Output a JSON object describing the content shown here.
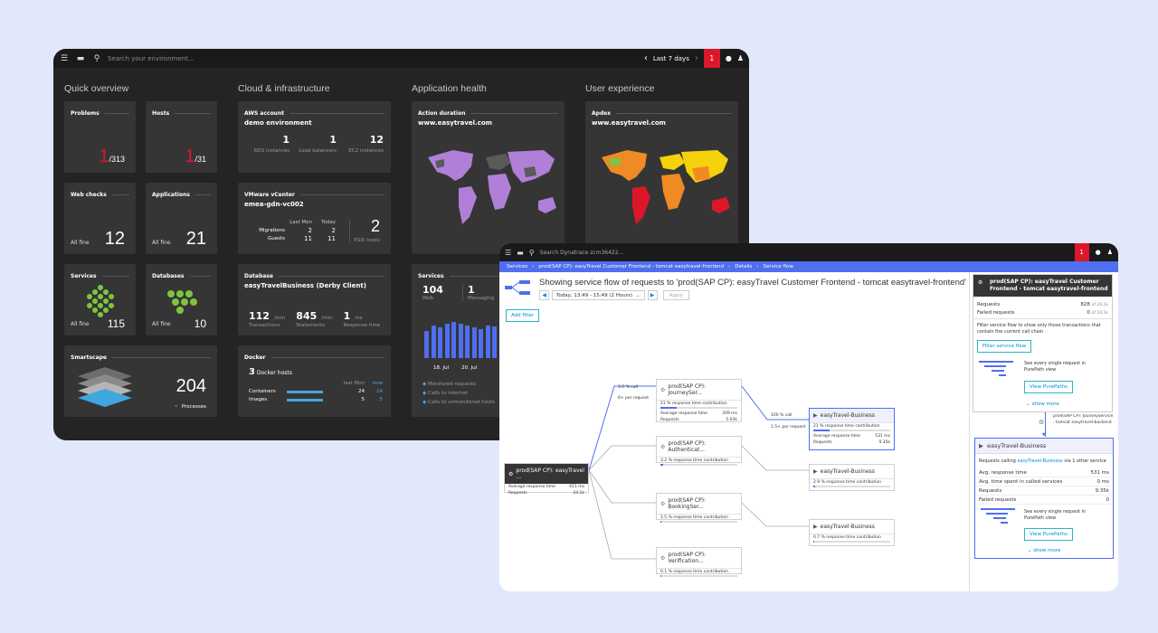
{
  "dark": {
    "search_placeholder": "Search your environment...",
    "timeframe": "Last 7 days",
    "problems_badge": "1",
    "sections": {
      "quick": "Quick overview",
      "cloud": "Cloud & infrastructure",
      "apphealth": "Application health",
      "ux": "User experience"
    },
    "problems": {
      "title": "Problems",
      "value": "1",
      "total": "/313"
    },
    "hosts": {
      "title": "Hosts",
      "value": "1",
      "total": "/31"
    },
    "webchecks": {
      "title": "Web checks",
      "status": "All fine",
      "value": "12"
    },
    "applications": {
      "title": "Applications",
      "status": "All fine",
      "value": "21"
    },
    "services": {
      "title": "Services",
      "status": "All fine",
      "value": "115"
    },
    "databases": {
      "title": "Databases",
      "status": "All fine",
      "value": "10"
    },
    "smartscape": {
      "title": "Smartscape",
      "value": "204",
      "label": "Processes"
    },
    "aws": {
      "title": "AWS account",
      "name": "demo environment",
      "rds": "1",
      "rds_label": "RDS instances",
      "lb": "1",
      "lb_label": "Load balancers",
      "ec2": "12",
      "ec2_label": "EC2 instances"
    },
    "vmware": {
      "title": "VMware vCenter",
      "name": "emea-gdn-vc002",
      "col1": "Last Mon",
      "col2": "Today",
      "migrations_label": "Migrations",
      "migrations_last": "2",
      "migrations_today": "2",
      "guests_label": "Guests",
      "guests_last": "11",
      "guests_today": "11",
      "esxi": "2",
      "esxi_label": "ESXi hosts"
    },
    "database": {
      "title": "Database",
      "name": "easyTravelBusiness (Derby Client)",
      "tx": "112",
      "tx_unit": "/min",
      "tx_label": "Transactions",
      "st": "845",
      "st_unit": "/min",
      "st_label": "Statements",
      "rt": "1",
      "rt_unit": "ms",
      "rt_label": "Response time"
    },
    "docker": {
      "title": "Docker",
      "hosts": "3",
      "hosts_label": "Docker hosts",
      "col1": "last Mon",
      "col2": "now",
      "containers_label": "Containers",
      "containers_last": "24",
      "containers_now": "24",
      "images_label": "Images",
      "images_last": "5",
      "images_now": "5"
    },
    "action": {
      "title": "Action duration",
      "site": "www.easytravel.com"
    },
    "apdex": {
      "title": "Apdex",
      "site": "www.easytravel.com"
    },
    "svc": {
      "title": "Services",
      "web": "104",
      "web_label": "Web",
      "msg": "1",
      "msg_label": "Messaging",
      "d1": "18. Jul",
      "d2": "20. Jul",
      "l1": "Monitored requests",
      "l2": "Calls to internet",
      "l3": "Calls to unmonitored hosts"
    }
  },
  "white": {
    "search_placeholder": "Search Dynatrace  zcm36422...",
    "problems_badge": "1",
    "crumbs": [
      "Services",
      "prod(SAP CP): easyTravel Customer Frontend - tomcat easytravel-frontend",
      "Details",
      "Service flow"
    ],
    "heading": "Showing service flow of requests to 'prod(SAP CP): easyTravel Customer Frontend - tomcat easytravel-frontend'",
    "timeframe": "Today, 13:49 - 15:49 (2 Hours)",
    "apply": "Apply",
    "add_filter": "Add filter",
    "root": {
      "name": "prod(SAP CP): easyTravel ...",
      "art_label": "Average response time",
      "art": "611 ms",
      "req_label": "Requests",
      "req": "24.1k"
    },
    "edges": {
      "e1_call": "3.5 % call",
      "e1_rate": "6+ per request",
      "e2_call": "100 % call",
      "e2_rate": "1.5+ per request"
    },
    "journey": {
      "name": "prod(SAP CP): JourneySer...",
      "contrib": "21 % response time contribution",
      "art_label": "Average response time",
      "art": "209 ms",
      "req_label": "Requests",
      "req": "5.03k"
    },
    "auth": {
      "name": "prod(SAP CP): Authenticat...",
      "contrib": "3.2 % response time contribution"
    },
    "booking": {
      "name": "prod(SAP CP): BookingSer...",
      "contrib": "1.5 % response time contribution"
    },
    "verif": {
      "name": "prod(SAP CP): Verification...",
      "contrib": "0.1 % response time contribution"
    },
    "etb1": {
      "name": "easyTravel-Business",
      "contrib": "21 % response time contribution",
      "art_label": "Average response time",
      "art": "531 ms",
      "req_label": "Requests",
      "req": "9.35k"
    },
    "etb2": {
      "name": "easyTravel-Business",
      "contrib": "2.9 % response time contribution"
    },
    "etb3": {
      "name": "easyTravel-Business",
      "contrib": "0.7 % response time contribution"
    },
    "panel1": {
      "title": "prod(SAP CP): easyTravel Customer Frontend - tomcat easytravel-frontend",
      "req_label": "Requests",
      "req": "828",
      "req_of": "of 24.1k",
      "failed_label": "Failed requests",
      "failed": "0",
      "failed_of": "of 24.1k",
      "desc": "Filter service flow to show only those transactions that contain the current call chain",
      "filter_btn": "Filter service flow",
      "pp_text": "See every single request in PurePath view",
      "pp_btn": "View PurePaths",
      "more": "show more"
    },
    "chain_label": "prod(SAP CP): JourneyService - tomcat easytravel-backend",
    "panel2": {
      "title": "easyTravel-Business",
      "calling_pre": "Requests calling ",
      "calling_link": "easyTravel-Business",
      "calling_post": " via 1 other service",
      "r1l": "Avg. response time",
      "r1v": "531 ms",
      "r2l": "Avg. time spent in called services",
      "r2v": "0 ms",
      "r3l": "Requests",
      "r3v": "9.35k",
      "r4l": "Failed requests",
      "r4v": "0",
      "pp_text": "See every single request in PurePath view",
      "pp_btn": "View PurePaths",
      "more": "show more"
    }
  },
  "colors": {
    "accent": "#4f6ef0",
    "red": "#dc172a",
    "teal": "#2ab6c2",
    "purple": "#b07fd8"
  }
}
